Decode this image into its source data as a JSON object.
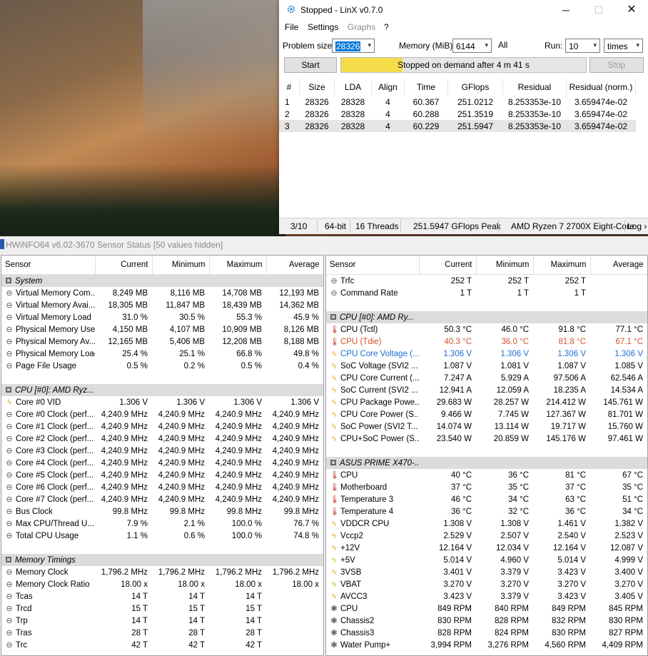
{
  "linx": {
    "title": "Stopped - LinX v0.7.0",
    "window_buttons": {
      "minimize": "─",
      "maximize": "☐",
      "close": "✕"
    },
    "menu": [
      "File",
      "Settings",
      "Graphs",
      "?"
    ],
    "problem_size_label": "Problem size:",
    "problem_size": "28326",
    "memory_label": "Memory (MiB):",
    "memory": "6144",
    "all_label": "All",
    "run_label": "Run:",
    "run_count": "10",
    "run_unit": "times",
    "start_label": "Start",
    "stop_label": "Stop",
    "progress_text": "Stopped on demand after 4 m 41 s",
    "progress_fraction": 0.25,
    "columns": [
      "#",
      "Size",
      "LDA",
      "Align",
      "Time",
      "GFlops",
      "Residual",
      "Residual (norm.)"
    ],
    "rows": [
      [
        "1",
        "28326",
        "28328",
        "4",
        "60.367",
        "251.0212",
        "8.253353e-10",
        "3.659474e-02"
      ],
      [
        "2",
        "28326",
        "28328",
        "4",
        "60.288",
        "251.3519",
        "8.253353e-10",
        "3.659474e-02"
      ],
      [
        "3",
        "28326",
        "28328",
        "4",
        "60.229",
        "251.5947",
        "8.253353e-10",
        "3.659474e-02"
      ]
    ],
    "status": [
      "3/10",
      "64-bit",
      "16 Threads",
      "251.5947 GFlops Peak",
      "AMD Ryzen 7 2700X Eight-Core",
      "Log ›"
    ]
  },
  "hwinfo": {
    "title": "HWiNFO64 v6.02-3670 Sensor Status [50 values hidden]",
    "columns": [
      "Sensor",
      "Current",
      "Minimum",
      "Maximum",
      "Average"
    ],
    "left": [
      {
        "type": "group",
        "name": "System"
      },
      {
        "icon": "clock",
        "name": "Virtual Memory Com...",
        "v": [
          "8,249 MB",
          "8,116 MB",
          "14,708 MB",
          "12,193 MB"
        ]
      },
      {
        "icon": "clock",
        "name": "Virtual Memory Avai...",
        "v": [
          "18,305 MB",
          "11,847 MB",
          "18,439 MB",
          "14,362 MB"
        ]
      },
      {
        "icon": "clock",
        "name": "Virtual Memory Load",
        "v": [
          "31.0 %",
          "30.5 %",
          "55.3 %",
          "45.9 %"
        ]
      },
      {
        "icon": "clock",
        "name": "Physical Memory Used",
        "v": [
          "4,150 MB",
          "4,107 MB",
          "10,909 MB",
          "8,126 MB"
        ]
      },
      {
        "icon": "clock",
        "name": "Physical Memory Av...",
        "v": [
          "12,165 MB",
          "5,406 MB",
          "12,208 MB",
          "8,188 MB"
        ]
      },
      {
        "icon": "clock",
        "name": "Physical Memory Load",
        "v": [
          "25.4 %",
          "25.1 %",
          "66.8 %",
          "49.8 %"
        ]
      },
      {
        "icon": "clock",
        "name": "Page File Usage",
        "v": [
          "0.5 %",
          "0.2 %",
          "0.5 %",
          "0.4 %"
        ]
      },
      {
        "type": "blank"
      },
      {
        "type": "group",
        "name": "CPU [#0]: AMD Ryz..."
      },
      {
        "icon": "bolt",
        "name": "Core #0 VID",
        "v": [
          "1.306 V",
          "1.306 V",
          "1.306 V",
          "1.306 V"
        ]
      },
      {
        "icon": "clock",
        "name": "Core #0 Clock (perf...",
        "v": [
          "4,240.9 MHz",
          "4,240.9 MHz",
          "4,240.9 MHz",
          "4,240.9 MHz"
        ]
      },
      {
        "icon": "clock",
        "name": "Core #1 Clock (perf...",
        "v": [
          "4,240.9 MHz",
          "4,240.9 MHz",
          "4,240.9 MHz",
          "4,240.9 MHz"
        ]
      },
      {
        "icon": "clock",
        "name": "Core #2 Clock (perf...",
        "v": [
          "4,240.9 MHz",
          "4,240.9 MHz",
          "4,240.9 MHz",
          "4,240.9 MHz"
        ]
      },
      {
        "icon": "clock",
        "name": "Core #3 Clock (perf...",
        "v": [
          "4,240.9 MHz",
          "4,240.9 MHz",
          "4,240.9 MHz",
          "4,240.9 MHz"
        ]
      },
      {
        "icon": "clock",
        "name": "Core #4 Clock (perf...",
        "v": [
          "4,240.9 MHz",
          "4,240.9 MHz",
          "4,240.9 MHz",
          "4,240.9 MHz"
        ]
      },
      {
        "icon": "clock",
        "name": "Core #5 Clock (perf...",
        "v": [
          "4,240.9 MHz",
          "4,240.9 MHz",
          "4,240.9 MHz",
          "4,240.9 MHz"
        ]
      },
      {
        "icon": "clock",
        "name": "Core #6 Clock (perf...",
        "v": [
          "4,240.9 MHz",
          "4,240.9 MHz",
          "4,240.9 MHz",
          "4,240.9 MHz"
        ]
      },
      {
        "icon": "clock",
        "name": "Core #7 Clock (perf...",
        "v": [
          "4,240.9 MHz",
          "4,240.9 MHz",
          "4,240.9 MHz",
          "4,240.9 MHz"
        ]
      },
      {
        "icon": "clock",
        "name": "Bus Clock",
        "v": [
          "99.8 MHz",
          "99.8 MHz",
          "99.8 MHz",
          "99.8 MHz"
        ]
      },
      {
        "icon": "clock",
        "name": "Max CPU/Thread U...",
        "v": [
          "7.9 %",
          "2.1 %",
          "100.0 %",
          "76.7 %"
        ]
      },
      {
        "icon": "clock",
        "name": "Total CPU Usage",
        "v": [
          "1.1 %",
          "0.6 %",
          "100.0 %",
          "74.8 %"
        ]
      },
      {
        "type": "blank"
      },
      {
        "type": "group",
        "name": "Memory Timings"
      },
      {
        "icon": "clock",
        "name": "Memory Clock",
        "v": [
          "1,796.2 MHz",
          "1,796.2 MHz",
          "1,796.2 MHz",
          "1,796.2 MHz"
        ]
      },
      {
        "icon": "clock",
        "name": "Memory Clock Ratio",
        "v": [
          "18.00 x",
          "18.00 x",
          "18.00 x",
          "18.00 x"
        ]
      },
      {
        "icon": "clock",
        "name": "Tcas",
        "v": [
          "14 T",
          "14 T",
          "14 T",
          ""
        ]
      },
      {
        "icon": "clock",
        "name": "Trcd",
        "v": [
          "15 T",
          "15 T",
          "15 T",
          ""
        ]
      },
      {
        "icon": "clock",
        "name": "Trp",
        "v": [
          "14 T",
          "14 T",
          "14 T",
          ""
        ]
      },
      {
        "icon": "clock",
        "name": "Tras",
        "v": [
          "28 T",
          "28 T",
          "28 T",
          ""
        ]
      },
      {
        "icon": "clock",
        "name": "Trc",
        "v": [
          "42 T",
          "42 T",
          "42 T",
          ""
        ]
      }
    ],
    "right": [
      {
        "icon": "clock",
        "name": "Trfc",
        "v": [
          "252 T",
          "252 T",
          "252 T",
          ""
        ]
      },
      {
        "icon": "clock",
        "name": "Command Rate",
        "v": [
          "1 T",
          "1 T",
          "1 T",
          ""
        ]
      },
      {
        "type": "blank"
      },
      {
        "type": "group",
        "name": "CPU [#0]: AMD Ry..."
      },
      {
        "icon": "therm",
        "name": "CPU (Tctl)",
        "v": [
          "50.3 °C",
          "46.0 °C",
          "91.8 °C",
          "77.1 °C"
        ]
      },
      {
        "icon": "therm",
        "name": "CPU (Tdie)",
        "style": "hl",
        "v": [
          "40.3 °C",
          "36.0 °C",
          "81.8 °C",
          "67.1 °C"
        ]
      },
      {
        "icon": "bolt",
        "name": "CPU Core Voltage (...",
        "style": "blue",
        "v": [
          "1.306 V",
          "1.306 V",
          "1.306 V",
          "1.306 V"
        ]
      },
      {
        "icon": "bolt",
        "name": "SoC Voltage (SVI2 ...",
        "v": [
          "1.087 V",
          "1.081 V",
          "1.087 V",
          "1.085 V"
        ]
      },
      {
        "icon": "bolt",
        "name": "CPU Core Current (...",
        "v": [
          "7.247 A",
          "5.929 A",
          "97.506 A",
          "62.546 A"
        ]
      },
      {
        "icon": "bolt",
        "name": "SoC Current (SVI2 ...",
        "v": [
          "12.941 A",
          "12.059 A",
          "18.235 A",
          "14.534 A"
        ]
      },
      {
        "icon": "bolt",
        "name": "CPU Package Powe...",
        "v": [
          "29.683 W",
          "28.257 W",
          "214.412 W",
          "145.761 W"
        ]
      },
      {
        "icon": "bolt",
        "name": "CPU Core Power (S...",
        "v": [
          "9.466 W",
          "7.745 W",
          "127.367 W",
          "81.701 W"
        ]
      },
      {
        "icon": "bolt",
        "name": "SoC Power (SVI2 T...",
        "v": [
          "14.074 W",
          "13.114 W",
          "19.717 W",
          "15.760 W"
        ]
      },
      {
        "icon": "bolt",
        "name": "CPU+SoC Power (S...",
        "v": [
          "23.540 W",
          "20.859 W",
          "145.176 W",
          "97.461 W"
        ]
      },
      {
        "type": "blank"
      },
      {
        "type": "group",
        "name": "ASUS PRIME X470-..."
      },
      {
        "icon": "therm",
        "name": "CPU",
        "v": [
          "40 °C",
          "36 °C",
          "81 °C",
          "67 °C"
        ]
      },
      {
        "icon": "therm",
        "name": "Motherboard",
        "v": [
          "37 °C",
          "35 °C",
          "37 °C",
          "35 °C"
        ]
      },
      {
        "icon": "therm",
        "name": "Temperature 3",
        "v": [
          "46 °C",
          "34 °C",
          "63 °C",
          "51 °C"
        ]
      },
      {
        "icon": "therm",
        "name": "Temperature 4",
        "v": [
          "36 °C",
          "32 °C",
          "36 °C",
          "34 °C"
        ]
      },
      {
        "icon": "bolt",
        "name": "VDDCR CPU",
        "v": [
          "1.308 V",
          "1.308 V",
          "1.461 V",
          "1.382 V"
        ]
      },
      {
        "icon": "bolt",
        "name": "Vccp2",
        "v": [
          "2.529 V",
          "2.507 V",
          "2.540 V",
          "2.523 V"
        ]
      },
      {
        "icon": "bolt",
        "name": "+12V",
        "v": [
          "12.164 V",
          "12.034 V",
          "12.164 V",
          "12.087 V"
        ]
      },
      {
        "icon": "bolt",
        "name": "+5V",
        "v": [
          "5.014 V",
          "4.960 V",
          "5.014 V",
          "4.999 V"
        ]
      },
      {
        "icon": "bolt",
        "name": "3VSB",
        "v": [
          "3.401 V",
          "3.379 V",
          "3.423 V",
          "3.400 V"
        ]
      },
      {
        "icon": "bolt",
        "name": "VBAT",
        "v": [
          "3.270 V",
          "3.270 V",
          "3.270 V",
          "3.270 V"
        ]
      },
      {
        "icon": "bolt",
        "name": "AVCC3",
        "v": [
          "3.423 V",
          "3.379 V",
          "3.423 V",
          "3.405 V"
        ]
      },
      {
        "icon": "fan",
        "name": "CPU",
        "v": [
          "849 RPM",
          "840 RPM",
          "849 RPM",
          "845 RPM"
        ]
      },
      {
        "icon": "fan",
        "name": "Chassis2",
        "v": [
          "830 RPM",
          "828 RPM",
          "832 RPM",
          "830 RPM"
        ]
      },
      {
        "icon": "fan",
        "name": "Chassis3",
        "v": [
          "828 RPM",
          "824 RPM",
          "830 RPM",
          "827 RPM"
        ]
      },
      {
        "icon": "fan",
        "name": "Water Pump+",
        "v": [
          "3,994 RPM",
          "3,276 RPM",
          "4,560 RPM",
          "4,409 RPM"
        ]
      }
    ]
  }
}
